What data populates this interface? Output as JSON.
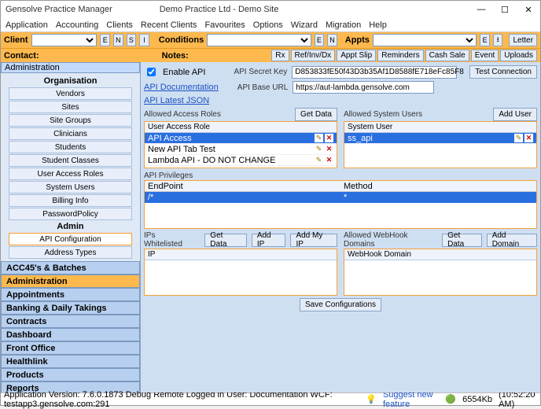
{
  "window": {
    "app_title": "Gensolve Practice Manager",
    "site_title": "Demo Practice Ltd - Demo Site"
  },
  "menu": [
    "Application",
    "Accounting",
    "Clients",
    "Recent Clients",
    "Favourites",
    "Options",
    "Wizard",
    "Migration",
    "Help"
  ],
  "toolbar": {
    "client_label": "Client",
    "letters": [
      "E",
      "N",
      "S",
      "I"
    ],
    "conditions_label": "Conditions",
    "cond_letters": [
      "E",
      "N"
    ],
    "appts_label": "Appts",
    "letter_btn": "Letter"
  },
  "contactbar": {
    "contact_label": "Contact:",
    "notes_label": "Notes:",
    "buttons": [
      "Rx",
      "Ref/Inv/Dx",
      "Appt Slip",
      "Reminders",
      "Cash Sale",
      "Event",
      "Uploads"
    ]
  },
  "nav": {
    "header": "Administration",
    "org_title": "Organisation",
    "org_items": [
      "Vendors",
      "Sites",
      "Site Groups",
      "Clinicians",
      "Students",
      "Student Classes",
      "User Access Roles",
      "System Users",
      "Billing Info",
      "PasswordPolicy"
    ],
    "admin_title": "Admin",
    "admin_items": [
      "API Configuration",
      "Address Types"
    ],
    "admin_selected": 0,
    "stacks": [
      "ACC45's & Batches",
      "Administration",
      "Appointments",
      "Banking & Daily Takings",
      "Contracts",
      "Dashboard",
      "Front Office",
      "Healthlink",
      "Products",
      "Reports"
    ],
    "stacks_selected": 1
  },
  "api": {
    "enable_label": "Enable API",
    "enable_checked": true,
    "secret_label": "API Secret Key",
    "secret_value": "D853833fE50f43D3b35Af1D8588fE718eFc85F8",
    "test_btn": "Test Connection",
    "doc_link": "API Documentation",
    "baseurl_label": "API Base URL",
    "baseurl_value": "https://aut-lambda.gensolve.com",
    "json_link": "API Latest JSON",
    "roles": {
      "title": "Allowed Access Roles",
      "getdata": "Get Data",
      "col": "User Access Role",
      "rows": [
        "API Access",
        "New API Tab Test",
        "Lambda API - DO NOT CHANGE"
      ],
      "selected": 0
    },
    "users": {
      "title": "Allowed System Users",
      "adduser": "Add User",
      "col": "System User",
      "rows": [
        "ss_api"
      ],
      "selected": 0
    },
    "priv": {
      "title": "API Privileges",
      "col1": "EndPoint",
      "col2": "Method",
      "ep": "/*",
      "method": "*"
    },
    "ips": {
      "title": "IPs Whitelisted",
      "getdata": "Get Data",
      "addip": "Add IP",
      "addmyip": "Add My IP",
      "col": "IP"
    },
    "webhook": {
      "title": "Allowed WebHook Domains",
      "getdata": "Get Data",
      "adddomain": "Add Domain",
      "col": "WebHook Domain"
    },
    "save": "Save Configurations"
  },
  "status": {
    "left": "Application Version: 7.6.0.1873 Debug Remote  Logged in User: Documentation WCF: testapp3.gensolve.com:291",
    "suggest": "Suggest new feature",
    "mem": "6554Kb",
    "time": "(10:52:20 AM)"
  }
}
